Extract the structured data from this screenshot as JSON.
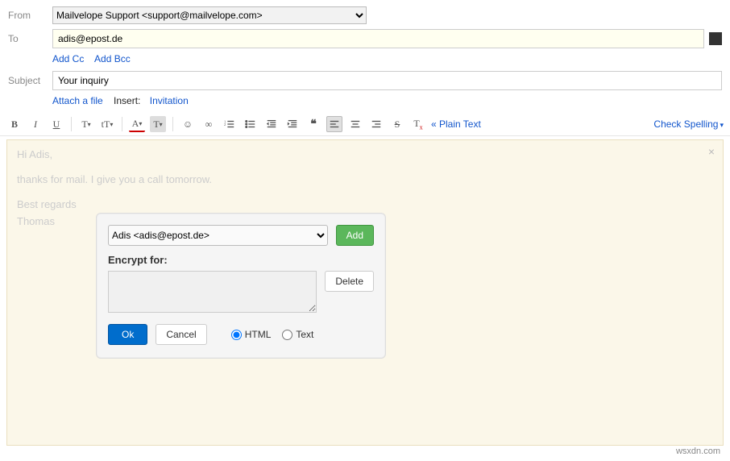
{
  "labels": {
    "from": "From",
    "to": "To",
    "subject": "Subject"
  },
  "from_value": "Mailvelope Support <support@mailvelope.com>",
  "to_value": "adis@epost.de",
  "subject_value": "Your inquiry",
  "links": {
    "add_cc": "Add Cc",
    "add_bcc": "Add Bcc",
    "attach": "Attach a file",
    "insert": "Insert:",
    "invitation": "Invitation",
    "plain_text": "« Plain Text",
    "check_spelling": "Check Spelling"
  },
  "toolbar": {
    "bold": "B",
    "italic": "I",
    "underline": "U",
    "font": "T",
    "size": "tT",
    "color": "A",
    "highlight": "T",
    "emoji": "☺",
    "link": "∞",
    "ol": "1≡",
    "ul": "•≡",
    "outdent": "⇤",
    "indent": "⇥",
    "quote": "❝",
    "align_left": "≡",
    "align_center": "≡",
    "align_right": "≡",
    "strike": "S̶",
    "clear": "Tx"
  },
  "editor": {
    "close": "×",
    "line1": "Hi Adis,",
    "line2": "thanks for mail. I give you a call tomorrow.",
    "line3": "Best regards",
    "line4": "Thomas"
  },
  "panel": {
    "recipient": "Adis <adis@epost.de>",
    "add": "Add",
    "encrypt_for": "Encrypt for:",
    "delete": "Delete",
    "ok": "Ok",
    "cancel": "Cancel",
    "html": "HTML",
    "text": "Text"
  },
  "watermark": "wsxdn.com"
}
